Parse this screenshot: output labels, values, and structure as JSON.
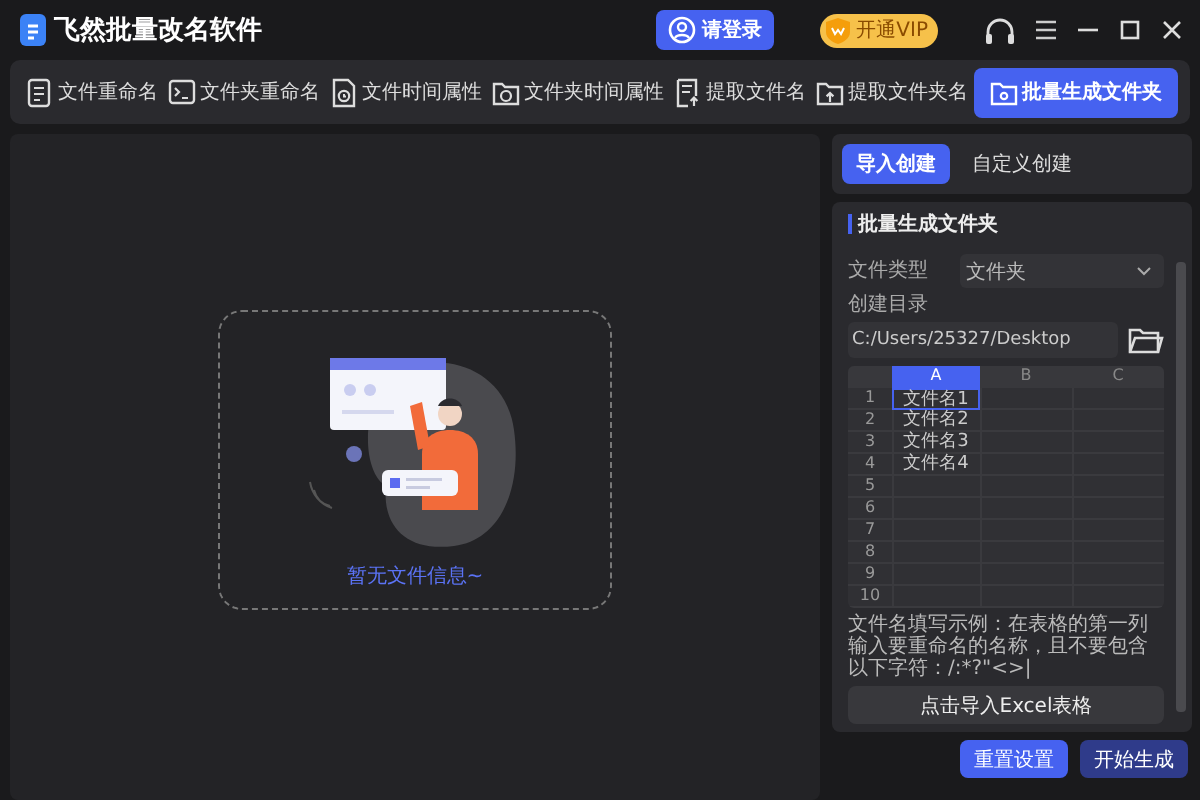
{
  "window": {
    "title": "飞然批量改名软件"
  },
  "header": {
    "login": "请登录",
    "vip": "开通VIP"
  },
  "tabs": [
    {
      "label": "文件重命名",
      "kind": "doc",
      "selected": false
    },
    {
      "label": "文件夹重命名",
      "kind": "terminal",
      "selected": false
    },
    {
      "label": "文件时间属性",
      "kind": "clock",
      "selected": false
    },
    {
      "label": "文件夹时间属性",
      "kind": "folderclock",
      "selected": false
    },
    {
      "label": "提取文件名",
      "kind": "docup",
      "selected": false
    },
    {
      "label": "提取文件夹名",
      "kind": "folderup",
      "selected": false
    },
    {
      "label": "批量生成文件夹",
      "kind": "folder",
      "selected": true
    }
  ],
  "drop_area": {
    "empty_text": "暂无文件信息~"
  },
  "mode_tabs": [
    {
      "label": "导入创建",
      "selected": true
    },
    {
      "label": "自定义创建",
      "selected": false
    }
  ],
  "section": {
    "title": "批量生成文件夹",
    "file_type": {
      "label": "文件类型",
      "value": "文件夹"
    },
    "directory": {
      "label": "创建目录",
      "value": "C:/Users/25327/Desktop"
    },
    "sheet": {
      "columns": [
        {
          "label": "A",
          "selected": true
        },
        {
          "label": "B",
          "selected": false
        },
        {
          "label": "C",
          "selected": false
        }
      ],
      "rows": [
        {
          "number": "1",
          "cells": [
            {
              "text": "文件名1",
              "selected": true
            }
          ]
        },
        {
          "number": "2",
          "cells": [
            {
              "text": "文件名2",
              "selected": false
            }
          ]
        },
        {
          "number": "3",
          "cells": [
            {
              "text": "文件名3",
              "selected": false
            }
          ]
        },
        {
          "number": "4",
          "cells": [
            {
              "text": "文件名4",
              "selected": false
            }
          ]
        },
        {
          "number": "5"
        },
        {
          "number": "6"
        },
        {
          "number": "7"
        },
        {
          "number": "8"
        },
        {
          "number": "9"
        },
        {
          "number": "10"
        }
      ]
    },
    "hint": "文件名填写示例：在表格的第一列输入要重命名的名称，且不要包含以下字符：/:*?\"<>|",
    "import_button": "点击导入Excel表格"
  },
  "buttons": [
    {
      "label": "重置设置",
      "kind": "primary"
    },
    {
      "label": "开始生成",
      "kind": "secondary"
    }
  ]
}
